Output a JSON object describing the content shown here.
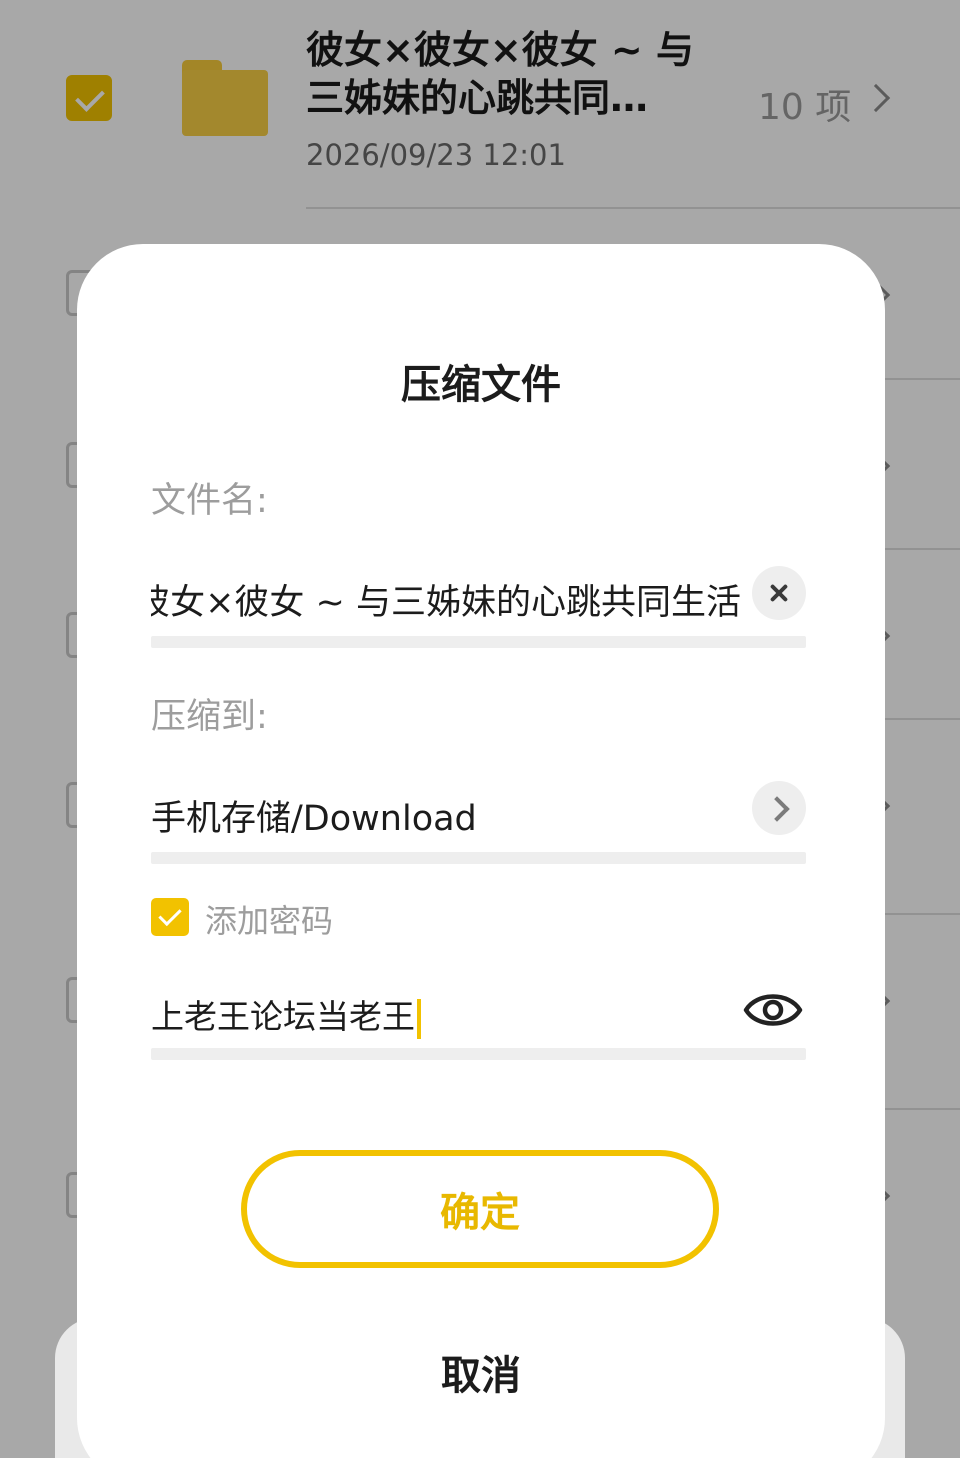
{
  "file_list": {
    "first_item": {
      "name": "彼女×彼女×彼女 ~ 与三姊妹的心跳共同…",
      "date": "2026/09/23 12:01",
      "count": "10 项",
      "checked": true
    }
  },
  "dialog": {
    "title": "压缩文件",
    "filename_label": "文件名:",
    "filename_value": "彼女×彼女 ~ 与三姊妹的心跳共同生活",
    "destination_label": "压缩到:",
    "destination_value": "手机存储/Download",
    "add_password_label": "添加密码",
    "add_password_checked": true,
    "password_value": "上老王论坛当老王",
    "confirm_label": "确定",
    "cancel_label": "取消"
  },
  "colors": {
    "accent": "#f2c200",
    "folder": "#f8cf45"
  }
}
